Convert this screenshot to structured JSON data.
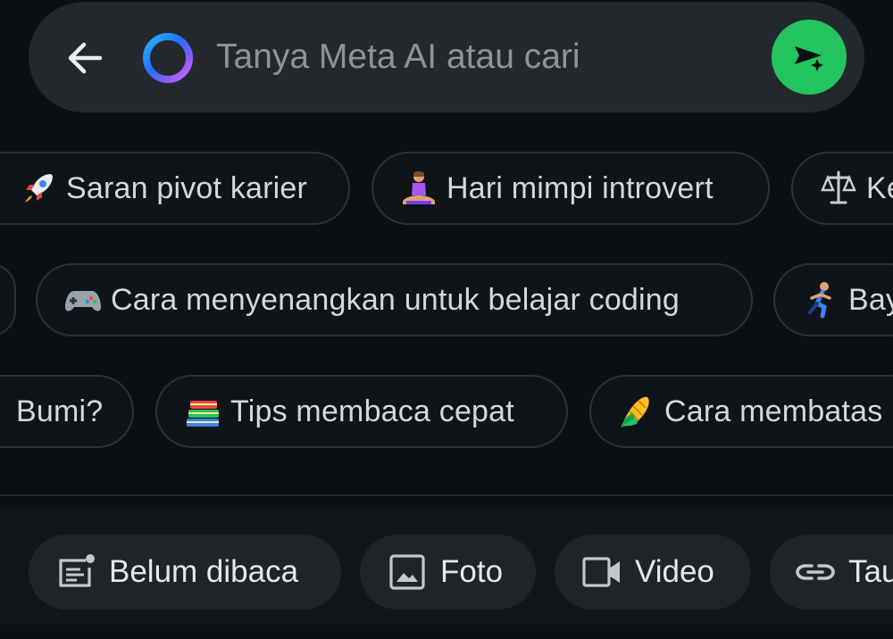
{
  "search": {
    "placeholder": "Tanya Meta AI atau cari",
    "icons": {
      "back": "arrow-left-icon",
      "ring": "meta-ai-ring-icon",
      "send": "send-sparkle-icon"
    },
    "accent_color": "#22c55e"
  },
  "suggestions": {
    "row1": [
      {
        "emoji": "rocket",
        "label": "Saran pivot karier"
      },
      {
        "emoji": "person-meditating",
        "label": "Hari mimpi introvert"
      },
      {
        "emoji": "balance-scale",
        "label": "Ke"
      }
    ],
    "row2": [
      {
        "emoji": "game-controller",
        "label": "Cara menyenangkan untuk belajar coding"
      },
      {
        "emoji": "person-running",
        "label": "Bay"
      }
    ],
    "row3": [
      {
        "emoji": "",
        "label": "Bumi?"
      },
      {
        "emoji": "books",
        "label": "Tips membaca cepat"
      },
      {
        "emoji": "corn",
        "label": "Cara membatas"
      }
    ]
  },
  "filters": [
    {
      "icon": "unread-icon",
      "label": "Belum dibaca"
    },
    {
      "icon": "photo-icon",
      "label": "Foto"
    },
    {
      "icon": "video-icon",
      "label": "Video"
    },
    {
      "icon": "link-icon",
      "label": "Tau"
    }
  ]
}
